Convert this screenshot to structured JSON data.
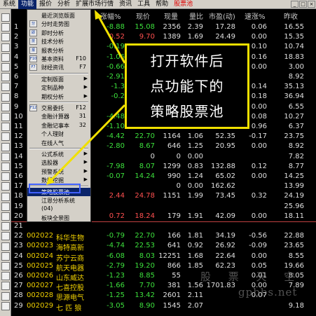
{
  "menubar": {
    "items": [
      "系统",
      "功能",
      "报价",
      "分析",
      "扩展市场行情",
      "资讯",
      "工具",
      "帮助"
    ],
    "active_index": 1,
    "stock_pool_label": "股票池",
    "win_buttons": [
      "_",
      "□",
      "×"
    ]
  },
  "columns": [
    "涨幅%",
    "现价",
    "现量",
    "量比",
    "市盈(动)",
    "速涨%",
    "昨收"
  ],
  "rows": [
    {
      "code": "",
      "name": "",
      "chg": "-8.88",
      "price": "15.08",
      "vol": "2356",
      "ratio": "2.39",
      "pe": "17.28",
      "spd": "0.06",
      "prev": "16.55",
      "chg_c": "g",
      "price_c": "g",
      "ratio_c": "w"
    },
    {
      "code": "",
      "name": "",
      "chg": "0.52",
      "price": "9.70",
      "vol": "1389",
      "ratio": "1.69",
      "pe": "24.49",
      "spd": "0.00",
      "prev": "15.35",
      "chg_c": "r",
      "price_c": "r",
      "ratio_c": "w"
    },
    {
      "code": "",
      "name": "",
      "chg": "-0.19",
      "price": "10.72",
      "vol": "1028",
      "ratio": "1.17",
      "pe": "69.00",
      "spd": "0.10",
      "prev": "10.74",
      "chg_c": "g",
      "price_c": "g",
      "ratio_c": "w"
    },
    {
      "code": "",
      "name": "",
      "chg": "-1.06",
      "price": "",
      "vol": "",
      "ratio": "",
      "pe": "",
      "spd": "0.16",
      "prev": "18.83",
      "chg_c": "g",
      "price_c": "g",
      "ratio_c": "w"
    },
    {
      "code": "",
      "name": "",
      "chg": "-0.66",
      "price": "",
      "vol": "",
      "ratio": "",
      "pe": "",
      "spd": "0.00",
      "prev": "3.00",
      "chg_c": "g",
      "price_c": "g",
      "ratio_c": "w"
    },
    {
      "code": "",
      "name": "",
      "chg": "-2.91",
      "price": "",
      "vol": "",
      "ratio": "",
      "pe": "",
      "spd": "",
      "prev": "8.92",
      "chg_c": "g",
      "price_c": "g",
      "ratio_c": "w"
    },
    {
      "code": "",
      "name": "",
      "chg": "-1.3",
      "price": "",
      "vol": "",
      "ratio": "",
      "pe": "",
      "spd": "0.14",
      "prev": "35.13",
      "chg_c": "g",
      "price_c": "g",
      "ratio_c": "w"
    },
    {
      "code": "",
      "name": "",
      "chg": "-0.2",
      "price": "",
      "vol": "",
      "ratio": "",
      "pe": "",
      "spd": "0.18",
      "prev": "36.94",
      "chg_c": "g",
      "price_c": "g",
      "ratio_c": "w"
    },
    {
      "code": "",
      "name": "",
      "chg": "",
      "price": "",
      "vol": "",
      "ratio": "",
      "pe": "",
      "spd": "0.00",
      "prev": "6.55",
      "chg_c": "g",
      "price_c": "g",
      "ratio_c": "w"
    },
    {
      "code": "",
      "name": "",
      "chg": "-4.48",
      "price": "",
      "vol": "",
      "ratio": "",
      "pe": "",
      "spd": "0.08",
      "prev": "10.27",
      "chg_c": "g",
      "price_c": "g",
      "ratio_c": "w"
    },
    {
      "code": "",
      "name": "",
      "chg": "-1.10",
      "price": "6.30",
      "vol": "2600",
      "ratio": "1.54",
      "pe": "61.02",
      "spd": "0.96",
      "prev": "6.37",
      "chg_c": "g",
      "price_c": "g",
      "ratio_c": "w"
    },
    {
      "code": "",
      "name": "",
      "chg": "-4.42",
      "price": "22.70",
      "vol": "1164",
      "ratio": "1.06",
      "pe": "52.35",
      "spd": "-0.17",
      "prev": "23.75",
      "chg_c": "g",
      "price_c": "g",
      "ratio_c": "w"
    },
    {
      "code": "",
      "name": "",
      "chg": "-2.80",
      "price": "8.67",
      "vol": "646",
      "ratio": "1.25",
      "pe": "20.95",
      "spd": "0.00",
      "prev": "8.92",
      "chg_c": "g",
      "price_c": "g",
      "ratio_c": "w"
    },
    {
      "code": "",
      "name": "",
      "chg": "",
      "price": "0",
      "vol": "0",
      "ratio": "0.00",
      "pe": "",
      "spd": "",
      "prev": "7.82",
      "chg_c": "g",
      "price_c": "w",
      "ratio_c": "w"
    },
    {
      "code": "",
      "name": "",
      "chg": "-7.98",
      "price": "8.07",
      "vol": "1299",
      "ratio": "0.83",
      "pe": "132.88",
      "spd": "0.12",
      "prev": "8.77",
      "chg_c": "g",
      "price_c": "g",
      "ratio_c": "w"
    },
    {
      "code": "",
      "name": "",
      "chg": "-0.07",
      "price": "14.24",
      "vol": "990",
      "ratio": "1.24",
      "pe": "65.02",
      "spd": "0.00",
      "prev": "14.25",
      "chg_c": "g",
      "price_c": "g",
      "ratio_c": "w"
    },
    {
      "code": "",
      "name": "",
      "chg": "",
      "price": "",
      "vol": "0",
      "ratio": "0.00",
      "pe": "162.62",
      "spd": "",
      "prev": "13.99",
      "chg_c": "g",
      "price_c": "w",
      "ratio_c": "w"
    },
    {
      "code": "",
      "name": "",
      "chg": "2.44",
      "price": "24.78",
      "vol": "1151",
      "ratio": "1.99",
      "pe": "73.45",
      "spd": "0.32",
      "prev": "24.19",
      "chg_c": "r",
      "price_c": "r",
      "ratio_c": "w"
    },
    {
      "code": "",
      "name": "",
      "chg": "",
      "price": "",
      "vol": "",
      "ratio": "",
      "pe": "",
      "spd": "",
      "prev": "25.96",
      "chg_c": "g",
      "price_c": "w",
      "ratio_c": "w"
    },
    {
      "code": "",
      "name": "",
      "chg": "0.72",
      "price": "18.24",
      "vol": "179",
      "ratio": "1.91",
      "pe": "42.09",
      "spd": "0.00",
      "prev": "18.11",
      "chg_c": "r",
      "price_c": "r",
      "ratio_c": "w"
    },
    {
      "code": "",
      "name": "",
      "chg": "",
      "price": "",
      "vol": "",
      "ratio": "",
      "pe": "",
      "spd": "",
      "prev": "",
      "chg_c": "g",
      "price_c": "w",
      "ratio_c": "w"
    },
    {
      "code": "002022",
      "name": "科华生物",
      "chg": "-0.79",
      "price": "22.70",
      "vol": "166",
      "ratio": "1.81",
      "pe": "34.19",
      "spd": "-0.56",
      "prev": "22.88",
      "chg_c": "g",
      "price_c": "g",
      "ratio_c": "w"
    },
    {
      "code": "002023",
      "name": "海特高新",
      "chg": "-4.74",
      "price": "22.53",
      "vol": "641",
      "ratio": "0.92",
      "pe": "26.92",
      "spd": "-0.09",
      "prev": "23.65",
      "chg_c": "g",
      "price_c": "g",
      "ratio_c": "w"
    },
    {
      "code": "002024",
      "name": "苏宁云商",
      "chg": "-6.08",
      "price": "8.03",
      "vol": "12251",
      "ratio": "1.68",
      "pe": "22.64",
      "spd": "0.00",
      "prev": "8.55",
      "chg_c": "g",
      "price_c": "g",
      "ratio_c": "w"
    },
    {
      "code": "002025",
      "name": "航天电器",
      "chg": "-2.79",
      "price": "19.20",
      "vol": "866",
      "ratio": "1.85",
      "pe": "62.23",
      "spd": "0.05",
      "prev": "19.66",
      "chg_c": "g",
      "price_c": "g",
      "ratio_c": "w"
    },
    {
      "code": "002026",
      "name": "山东威达",
      "chg": "-1.23",
      "price": "8.85",
      "vol": "55",
      "ratio": "",
      "pe": "",
      "spd": "0.01",
      "prev": "8.05",
      "chg_c": "g",
      "price_c": "g",
      "ratio_c": "w"
    },
    {
      "code": "002027",
      "name": "七喜控股",
      "chg": "-1.66",
      "price": "7.70",
      "vol": "381",
      "ratio": "1.56",
      "pe": "1701.83",
      "spd": "0.00",
      "prev": "7.89",
      "chg_c": "g",
      "price_c": "g",
      "ratio_c": "w"
    },
    {
      "code": "002028",
      "name": "思源电气",
      "chg": "-1.25",
      "price": "13.42",
      "vol": "2601",
      "ratio": "2.11",
      "pe": "",
      "spd": "0.07",
      "prev": "",
      "chg_c": "g",
      "price_c": "g",
      "ratio_c": "w"
    },
    {
      "code": "002029",
      "name": "七 匹 狼",
      "chg": "-3.05",
      "price": "8.90",
      "vol": "1545",
      "ratio": "2.07",
      "pe": "",
      "spd": "",
      "prev": "9.18",
      "chg_c": "g",
      "price_c": "g",
      "ratio_c": "w"
    }
  ],
  "row_numbers": [
    "1",
    "2",
    "3",
    "4",
    "5",
    "6",
    "7",
    "8",
    "9",
    "10",
    "11",
    "12",
    "13",
    "14",
    "15",
    "16",
    "17",
    "18",
    "19",
    "20",
    "21",
    "22",
    "23",
    "24",
    "25",
    "26",
    "27",
    "28",
    "29"
  ],
  "dropdown": {
    "items": [
      {
        "label": "最近浏览版面",
        "shortcut": "",
        "arrow": false,
        "icon": ""
      },
      {
        "label": "分时走势图",
        "shortcut": "",
        "arrow": false,
        "icon": "分"
      },
      {
        "label": "即时分析",
        "shortcut": "",
        "arrow": false,
        "icon": "即"
      },
      {
        "label": "技术分析",
        "shortcut": "",
        "arrow": false,
        "icon": "技"
      },
      {
        "label": "报表分析",
        "shortcut": "",
        "arrow": false,
        "icon": "报"
      },
      {
        "label": "基本资料",
        "shortcut": "F10",
        "arrow": false,
        "icon": "F10"
      },
      {
        "label": "财经资讯",
        "shortcut": "F7",
        "arrow": false,
        "icon": "F7"
      },
      {
        "label": "定制版面",
        "shortcut": "",
        "arrow": true,
        "icon": ""
      },
      {
        "label": "定制品种",
        "shortcut": "",
        "arrow": true,
        "icon": ""
      },
      {
        "label": "期权分析",
        "shortcut": "",
        "arrow": true,
        "icon": ""
      },
      {
        "label": "交易委托",
        "shortcut": "F12",
        "arrow": false,
        "icon": "F12"
      },
      {
        "label": "金融计算器",
        "shortcut": "31",
        "arrow": false,
        "icon": ""
      },
      {
        "label": "金融记事本",
        "shortcut": "32",
        "arrow": false,
        "icon": ""
      },
      {
        "label": "个人理财",
        "shortcut": "",
        "arrow": false,
        "icon": ""
      },
      {
        "label": "在线人气",
        "shortcut": "",
        "arrow": false,
        "icon": ""
      },
      {
        "label": "公式系统",
        "shortcut": "",
        "arrow": true,
        "icon": ""
      },
      {
        "label": "选股器",
        "shortcut": "",
        "arrow": true,
        "icon": ""
      },
      {
        "label": "预警系统",
        "shortcut": "",
        "arrow": true,
        "icon": ""
      },
      {
        "label": "数据挖掘",
        "shortcut": "",
        "arrow": true,
        "icon": ""
      },
      {
        "label": "策略股票池",
        "shortcut": "",
        "arrow": false,
        "icon": ""
      },
      {
        "label": "江恩分析系统",
        "shortcut": "",
        "arrow": false,
        "icon": ""
      },
      {
        "label": "(04)",
        "shortcut": "",
        "arrow": false,
        "icon": ""
      },
      {
        "label": "板块全景图",
        "shortcut": "",
        "arrow": false,
        "icon": ""
      },
      {
        "label": "热点星空图",
        "shortcut": "",
        "arrow": false,
        "icon": ""
      }
    ],
    "selected_index": 19
  },
  "annotation": {
    "lines": [
      "打开软件后",
      "点功能下的",
      "策略股票池"
    ]
  },
  "overlay_code": "(04)",
  "watermark": "股 票 天 空",
  "watermark_url": "gpbbs.net",
  "colors": {
    "up": "#ff5050",
    "down": "#3ce03c",
    "accent": "#f0e000",
    "highlight": "#4060ff"
  }
}
